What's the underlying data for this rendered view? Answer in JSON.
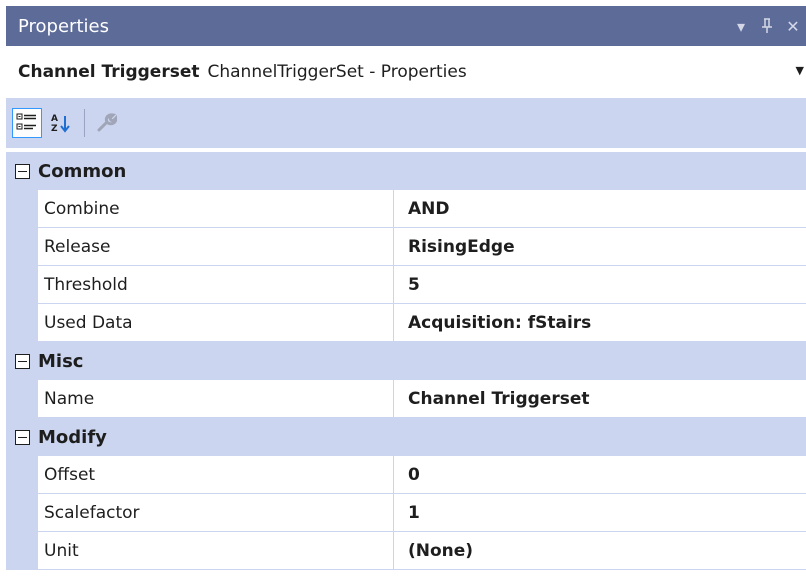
{
  "window": {
    "title": "Properties",
    "ctrl_dropdown": "▾",
    "ctrl_pin": "ᚹ",
    "ctrl_close": "✕"
  },
  "object_selector": {
    "name": "Channel Triggerset",
    "type": "ChannelTriggerSet - Properties"
  },
  "toolbar": {
    "buttons": [
      {
        "icon": "categorized-icon",
        "active": true
      },
      {
        "icon": "alphabetical-icon",
        "active": false
      },
      {
        "icon": "property-pages-icon",
        "active": false
      }
    ]
  },
  "grid": {
    "categories": [
      {
        "label": "Common",
        "properties": [
          {
            "name": "Combine",
            "value": "AND"
          },
          {
            "name": "Release",
            "value": "RisingEdge"
          },
          {
            "name": "Threshold",
            "value": "5"
          },
          {
            "name": "Used Data",
            "value": "Acquisition: fStairs"
          }
        ]
      },
      {
        "label": "Misc",
        "properties": [
          {
            "name": "Name",
            "value": "Channel Triggerset"
          }
        ]
      },
      {
        "label": "Modify",
        "properties": [
          {
            "name": "Offset",
            "value": "0"
          },
          {
            "name": "Scalefactor",
            "value": "1"
          },
          {
            "name": "Unit",
            "value": "(None)"
          }
        ]
      }
    ]
  },
  "colors": {
    "titlebar": "#5d6b99",
    "category_background": "#ccd5f0",
    "toolbar_background": "#ccd5f0"
  }
}
